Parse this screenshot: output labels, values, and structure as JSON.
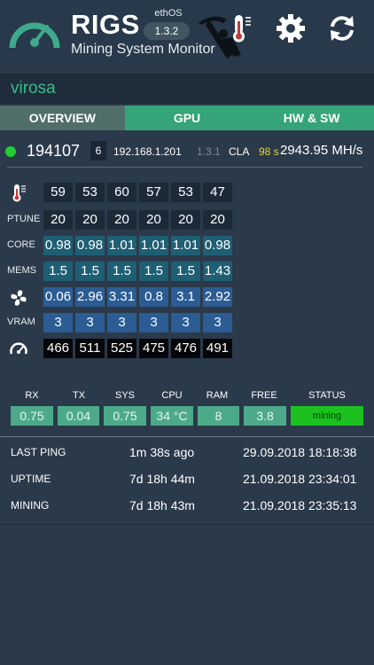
{
  "header": {
    "brand": "RIGS",
    "subtitle": "Mining System Monitor",
    "os_label": "ethOS",
    "os_version": "1.3.2",
    "icons": [
      "gauge-logo-icon",
      "miner-figure-icon",
      "thermometer-icon",
      "gear-icon",
      "refresh-icon"
    ]
  },
  "rig": {
    "name": "virosa",
    "id": "194107",
    "gpu_count": "6",
    "ip": "192.168.1.201",
    "version": "1.3.1",
    "miner": "CLA",
    "uptime_s": "98 s",
    "hashrate": "2943.95 MH/s"
  },
  "tabs": [
    "OVERVIEW",
    "GPU",
    "HW & SW"
  ],
  "gpu_table": {
    "rows": [
      {
        "label": "",
        "icon": "thermometer-icon",
        "style": "dark",
        "values": [
          "59",
          "53",
          "60",
          "57",
          "53",
          "47"
        ]
      },
      {
        "label": "PTUNE",
        "style": "dark",
        "values": [
          "20",
          "20",
          "20",
          "20",
          "20",
          "20"
        ]
      },
      {
        "label": "CORE",
        "style": "teal",
        "values": [
          "0.98",
          "0.98",
          "1.01",
          "1.01",
          "1.01",
          "0.98"
        ]
      },
      {
        "label": "MEMS",
        "style": "teal",
        "values": [
          "1.5",
          "1.5",
          "1.5",
          "1.5",
          "1.5",
          "1.43"
        ]
      },
      {
        "label": "",
        "icon": "fan-icon",
        "style": "blue",
        "values": [
          "0.06",
          "2.96",
          "3.31",
          "0.8",
          "3.1",
          "2.92"
        ]
      },
      {
        "label": "VRAM",
        "style": "blue",
        "values": [
          "3",
          "3",
          "3",
          "3",
          "3",
          "3"
        ]
      },
      {
        "label": "",
        "icon": "speedometer-icon",
        "style": "black",
        "values": [
          "466",
          "511",
          "525",
          "475",
          "476",
          "491"
        ]
      }
    ]
  },
  "summary": {
    "headers": [
      "RX",
      "TX",
      "SYS",
      "CPU",
      "RAM",
      "FREE",
      "STATUS"
    ],
    "values": [
      "0.75",
      "0.04",
      "0.75",
      "34 °C",
      "8",
      "3.8",
      "mining"
    ]
  },
  "info": [
    {
      "label": "LAST PING",
      "mid": "1m 38s  ago",
      "right": "29.09.2018 18:18:38"
    },
    {
      "label": "UPTIME",
      "mid": "7d 18h 44m",
      "right": "21.09.2018 23:34:01"
    },
    {
      "label": "MINING",
      "mid": "7d 18h 43m",
      "right": "21.09.2018 23:35:13"
    }
  ],
  "colors": {
    "accent_green": "#35a478",
    "rig_name": "#3cb98a",
    "status_ok": "#1bc21f",
    "uptime_yellow": "#e3d43a"
  }
}
